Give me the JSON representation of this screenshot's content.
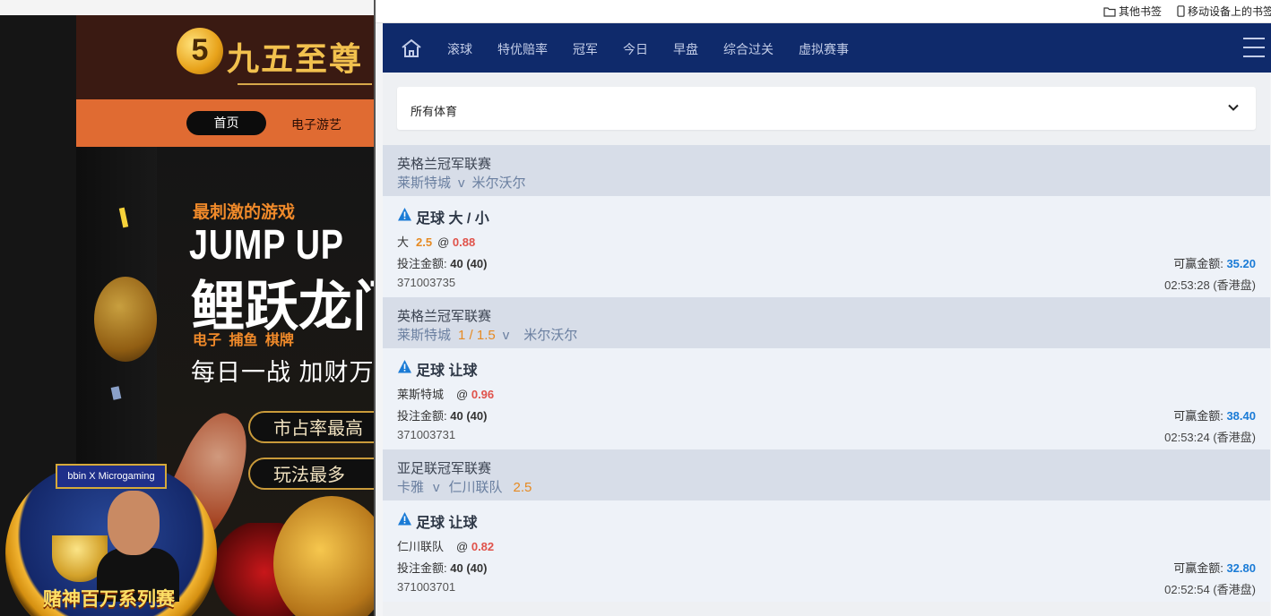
{
  "left_site": {
    "logo_numeral": "5",
    "logo_text": "九五至尊",
    "nav": {
      "home": "首页",
      "games": "电子游艺"
    },
    "banner": {
      "kicker": "最刺激的游戏",
      "title": "JUMP UP",
      "title_cn": "鲤跃龙门",
      "categories": "电子 捕鱼 棋牌",
      "slogan": "每日一战 加财万",
      "pills": [
        "市占率最高",
        "玩法最多"
      ]
    },
    "badge": {
      "brand": "bbin X Microgaming",
      "title": "赌神百万系列赛"
    }
  },
  "browser": {
    "bookmarks": [
      {
        "label": "其他书签",
        "icon": "folder-icon"
      },
      {
        "label": "移动设备上的书签",
        "icon": "mobile-icon"
      }
    ]
  },
  "sportsbook": {
    "nav_items": [
      "滚球",
      "特优赔率",
      "冠军",
      "今日",
      "早盘",
      "综合过关",
      "虚拟赛事"
    ],
    "sport_filter": "所有体育",
    "labels": {
      "stake": "投注金额:",
      "win": "可赢金额:",
      "at": "@"
    },
    "bets": [
      {
        "league": "英格兰冠军联赛",
        "home": "莱斯特城",
        "vs": "v",
        "away": "米尔沃尔",
        "match_hdp": "",
        "bet_type": "足球 大 / 小",
        "selection": "大",
        "sel_hdp": "2.5",
        "odds": "0.88",
        "stake": "40 (40)",
        "win": "35.20",
        "id": "371003735",
        "time": "02:53:28 (香港盘)"
      },
      {
        "league": "英格兰冠军联赛",
        "home": "莱斯特城",
        "vs": "v",
        "away": "米尔沃尔",
        "match_hdp": "1 / 1.5",
        "bet_type": "足球 让球",
        "selection": "莱斯特城",
        "sel_hdp": "",
        "odds": "0.96",
        "stake": "40 (40)",
        "win": "38.40",
        "id": "371003731",
        "time": "02:53:24 (香港盘)"
      },
      {
        "league": "亚足联冠军联赛",
        "home": "卡雅",
        "vs": "v",
        "away": "仁川联队",
        "match_hdp": "2.5",
        "bet_type": "足球 让球",
        "selection": "仁川联队",
        "sel_hdp": "",
        "odds": "0.82",
        "stake": "40 (40)",
        "win": "32.80",
        "id": "371003701",
        "time": "02:52:54 (香港盘)"
      }
    ]
  },
  "colors": {
    "nav_bg": "#0f2a6b",
    "odds": "#e0524a",
    "handicap": "#e68a22",
    "win_amount": "#1a7bd6",
    "card_header": "#d7dde8"
  }
}
